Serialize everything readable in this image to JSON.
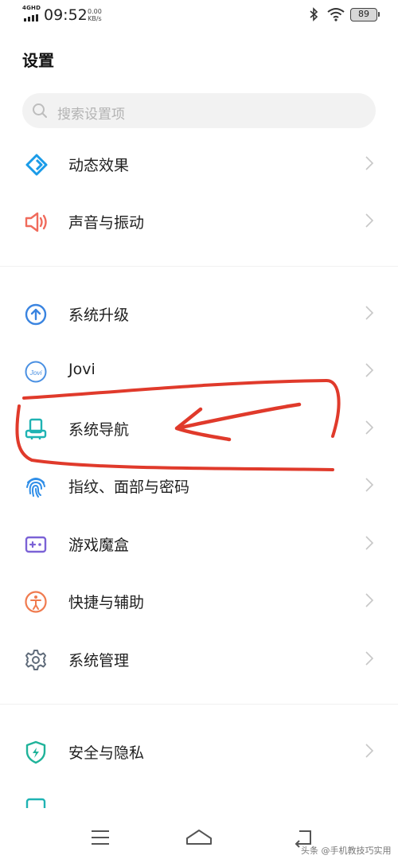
{
  "status_bar": {
    "network": "4GHD",
    "time": "09:52",
    "speed_value": "0.00",
    "speed_unit": "KB/s",
    "battery": "89"
  },
  "page": {
    "title": "设置"
  },
  "search": {
    "placeholder": "搜索设置项"
  },
  "items": [
    {
      "label": "动态效果",
      "icon": "dynamic-effects-icon",
      "color": "#1a9be8"
    },
    {
      "label": "声音与振动",
      "icon": "speaker-icon",
      "color": "#f06b5c"
    },
    {
      "label": "系统升级",
      "icon": "upgrade-arrow-icon",
      "color": "#3a84e0"
    },
    {
      "label": "Jovi",
      "icon": "jovi-icon",
      "color": "#4a90e2"
    },
    {
      "label": "系统导航",
      "icon": "system-navigation-icon",
      "color": "#1fb3b3"
    },
    {
      "label": "指纹、面部与密码",
      "icon": "fingerprint-icon",
      "color": "#2f8ee8"
    },
    {
      "label": "游戏魔盒",
      "icon": "game-box-icon",
      "color": "#7b62d6"
    },
    {
      "label": "快捷与辅助",
      "icon": "accessibility-icon",
      "color": "#f07b4f"
    },
    {
      "label": "系统管理",
      "icon": "gear-icon",
      "color": "#5f6b7a"
    },
    {
      "label": "安全与隐私",
      "icon": "shield-icon",
      "color": "#1fb39a"
    }
  ],
  "watermark": "头条 @手机教技巧实用",
  "annotation_color": "#e03a2b"
}
